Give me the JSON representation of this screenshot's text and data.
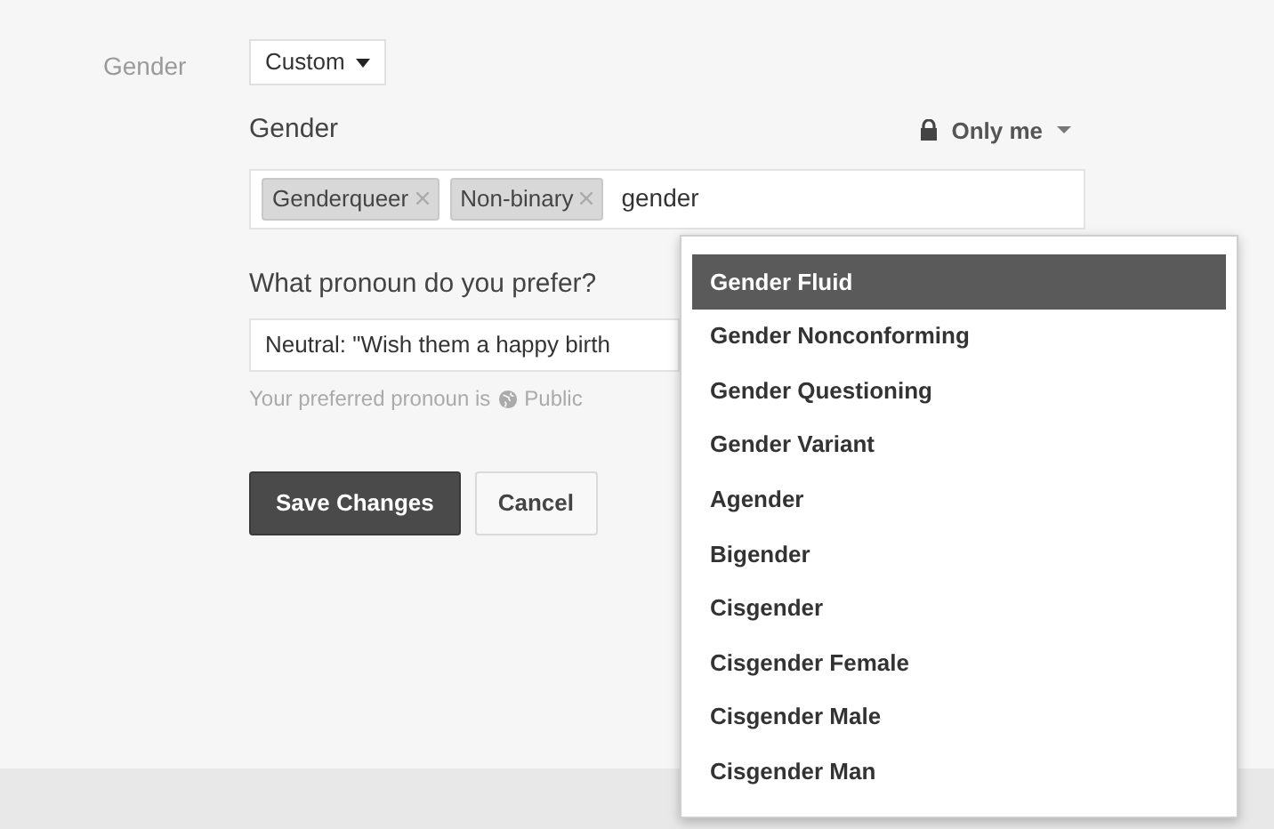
{
  "field_label": "Gender",
  "gender_select": {
    "value": "Custom"
  },
  "custom_label": "Gender",
  "audience": {
    "label": "Only me"
  },
  "tokens": [
    {
      "label": "Genderqueer"
    },
    {
      "label": "Non-binary"
    }
  ],
  "token_input": {
    "value": "gender"
  },
  "suggestions": [
    {
      "label": "Gender Fluid",
      "selected": true
    },
    {
      "label": "Gender Nonconforming",
      "selected": false
    },
    {
      "label": "Gender Questioning",
      "selected": false
    },
    {
      "label": "Gender Variant",
      "selected": false
    },
    {
      "label": "Agender",
      "selected": false
    },
    {
      "label": "Bigender",
      "selected": false
    },
    {
      "label": "Cisgender",
      "selected": false
    },
    {
      "label": "Cisgender Female",
      "selected": false
    },
    {
      "label": "Cisgender Male",
      "selected": false
    },
    {
      "label": "Cisgender Man",
      "selected": false
    }
  ],
  "pronoun_question": "What pronoun do you prefer?",
  "pronoun_select": {
    "value": "Neutral: \"Wish them a happy birth"
  },
  "pronoun_note": {
    "text": "Your preferred pronoun is",
    "audience": "Public"
  },
  "buttons": {
    "save": "Save Changes",
    "cancel": "Cancel"
  }
}
